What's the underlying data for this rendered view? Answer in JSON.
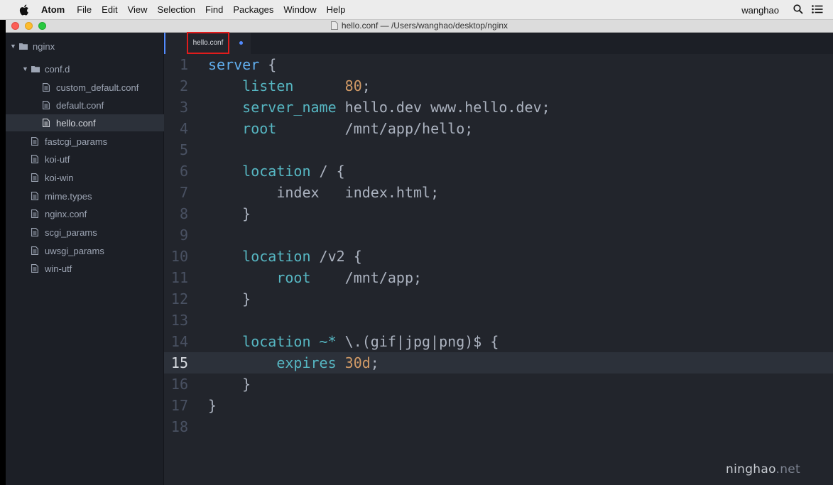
{
  "menubar": {
    "app_name": "Atom",
    "items": [
      "File",
      "Edit",
      "View",
      "Selection",
      "Find",
      "Packages",
      "Window",
      "Help"
    ],
    "user": "wanghao"
  },
  "window": {
    "title": "hello.conf — /Users/wanghao/desktop/nginx"
  },
  "tree": {
    "root": "nginx",
    "folder": "conf.d",
    "subfiles": [
      "custom_default.conf",
      "default.conf",
      "hello.conf"
    ],
    "selected": "hello.conf",
    "files": [
      "fastcgi_params",
      "koi-utf",
      "koi-win",
      "mime.types",
      "nginx.conf",
      "scgi_params",
      "uwsgi_params",
      "win-utf"
    ]
  },
  "tab": {
    "label": "hello.conf",
    "modified": true
  },
  "editor": {
    "current_line": 15,
    "lines": [
      {
        "n": "1"
      },
      {
        "n": "2"
      },
      {
        "n": "3"
      },
      {
        "n": "4"
      },
      {
        "n": "5"
      },
      {
        "n": "6"
      },
      {
        "n": "7"
      },
      {
        "n": "8"
      },
      {
        "n": "9"
      },
      {
        "n": "10"
      },
      {
        "n": "11"
      },
      {
        "n": "12"
      },
      {
        "n": "13"
      },
      {
        "n": "14"
      },
      {
        "n": "15"
      },
      {
        "n": "16"
      },
      {
        "n": "17"
      },
      {
        "n": "18"
      }
    ],
    "code": {
      "l1": {
        "a": "server",
        "b": " {"
      },
      "l2": {
        "a": "listen",
        "b": "      ",
        "c": "80",
        "d": ";"
      },
      "l3": {
        "a": "server_name",
        "b": " hello.dev www.hello.dev;"
      },
      "l4": {
        "a": "root",
        "b": "        /mnt/app/hello;"
      },
      "l6": {
        "a": "location",
        "b": " / {"
      },
      "l7": {
        "a": "index",
        "b": "   index.html;"
      },
      "l8": {
        "a": "}"
      },
      "l10": {
        "a": "location",
        "b": " /v2 {"
      },
      "l11": {
        "a": "root",
        "b": "    /mnt/app;"
      },
      "l12": {
        "a": "}"
      },
      "l14": {
        "a": "location",
        "b": " ",
        "c": "~*",
        "d": " \\.(gif|jpg|png)$ {"
      },
      "l15": {
        "a": "expires",
        "b": " ",
        "c": "30d",
        "d": ";"
      },
      "l16": {
        "a": "}"
      },
      "l17": {
        "a": "}"
      }
    }
  },
  "watermark": {
    "brand": "ninghao",
    "suffix": ".net"
  },
  "colors": {
    "keyword": "#56b6c2",
    "number": "#d19a66",
    "accent": "#528bff",
    "highlight_box": "#e01c1c"
  }
}
